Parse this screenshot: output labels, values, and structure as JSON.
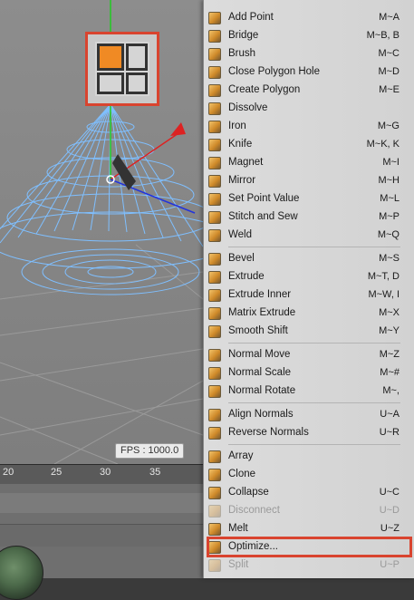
{
  "viewport": {
    "fps_text": "FPS : 1000.0",
    "timeline_ticks": [
      "20",
      "25",
      "30",
      "35"
    ]
  },
  "colors": {
    "highlight_border": "#d9442f",
    "icon_orange": "#f08a24",
    "wireframe": "#6fb4ff",
    "axis_red": "#d22",
    "axis_green": "#2c2"
  },
  "menu": {
    "groups": [
      [
        {
          "label": "Add Point",
          "shortcut": "M~A",
          "icon": "add-point-icon",
          "enabled": true
        },
        {
          "label": "Bridge",
          "shortcut": "M~B, B",
          "icon": "bridge-icon",
          "enabled": true
        },
        {
          "label": "Brush",
          "shortcut": "M~C",
          "icon": "brush-icon",
          "enabled": true
        },
        {
          "label": "Close Polygon Hole",
          "shortcut": "M~D",
          "icon": "close-polygon-hole-icon",
          "enabled": true
        },
        {
          "label": "Create Polygon",
          "shortcut": "M~E",
          "icon": "create-polygon-icon",
          "enabled": true
        },
        {
          "label": "Dissolve",
          "shortcut": "",
          "icon": "dissolve-icon",
          "enabled": true
        },
        {
          "label": "Iron",
          "shortcut": "M~G",
          "icon": "iron-icon",
          "enabled": true
        },
        {
          "label": "Knife",
          "shortcut": "M~K, K",
          "icon": "knife-icon",
          "enabled": true
        },
        {
          "label": "Magnet",
          "shortcut": "M~I",
          "icon": "magnet-icon",
          "enabled": true
        },
        {
          "label": "Mirror",
          "shortcut": "M~H",
          "icon": "mirror-icon",
          "enabled": true
        },
        {
          "label": "Set Point Value",
          "shortcut": "M~L",
          "icon": "set-point-value-icon",
          "enabled": true
        },
        {
          "label": "Stitch and Sew",
          "shortcut": "M~P",
          "icon": "stitch-and-sew-icon",
          "enabled": true
        },
        {
          "label": "Weld",
          "shortcut": "M~Q",
          "icon": "weld-icon",
          "enabled": true
        }
      ],
      [
        {
          "label": "Bevel",
          "shortcut": "M~S",
          "icon": "bevel-icon",
          "enabled": true
        },
        {
          "label": "Extrude",
          "shortcut": "M~T, D",
          "icon": "extrude-icon",
          "enabled": true
        },
        {
          "label": "Extrude Inner",
          "shortcut": "M~W, I",
          "icon": "extrude-inner-icon",
          "enabled": true
        },
        {
          "label": "Matrix Extrude",
          "shortcut": "M~X",
          "icon": "matrix-extrude-icon",
          "enabled": true
        },
        {
          "label": "Smooth Shift",
          "shortcut": "M~Y",
          "icon": "smooth-shift-icon",
          "enabled": true
        }
      ],
      [
        {
          "label": "Normal Move",
          "shortcut": "M~Z",
          "icon": "normal-move-icon",
          "enabled": true
        },
        {
          "label": "Normal Scale",
          "shortcut": "M~#",
          "icon": "normal-scale-icon",
          "enabled": true
        },
        {
          "label": "Normal Rotate",
          "shortcut": "M~,",
          "icon": "normal-rotate-icon",
          "enabled": true
        }
      ],
      [
        {
          "label": "Align Normals",
          "shortcut": "U~A",
          "icon": "align-normals-icon",
          "enabled": true
        },
        {
          "label": "Reverse Normals",
          "shortcut": "U~R",
          "icon": "reverse-normals-icon",
          "enabled": true
        }
      ],
      [
        {
          "label": "Array",
          "shortcut": "",
          "icon": "array-icon",
          "enabled": true
        },
        {
          "label": "Clone",
          "shortcut": "",
          "icon": "clone-icon",
          "enabled": true
        },
        {
          "label": "Collapse",
          "shortcut": "U~C",
          "icon": "collapse-icon",
          "enabled": true
        },
        {
          "label": "Disconnect",
          "shortcut": "U~D",
          "icon": "disconnect-icon",
          "enabled": false
        },
        {
          "label": "Melt",
          "shortcut": "U~Z",
          "icon": "melt-icon",
          "enabled": true
        },
        {
          "label": "Optimize...",
          "shortcut": "",
          "icon": "optimize-icon",
          "enabled": true,
          "highlighted": true
        },
        {
          "label": "Split",
          "shortcut": "U~P",
          "icon": "split-icon",
          "enabled": false
        }
      ]
    ]
  }
}
